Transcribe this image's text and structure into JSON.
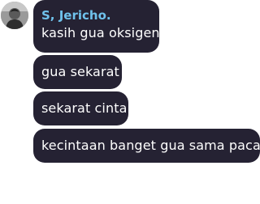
{
  "chat": {
    "sender_name": "S, Jericho.",
    "messages": [
      {
        "text": "kasih gua oksigen"
      },
      {
        "text": "gua sekarat"
      },
      {
        "text": "sekarat cinta"
      },
      {
        "text": "kecintaan banget gua sama pacar"
      }
    ]
  },
  "colors": {
    "bubble_background": "#252233",
    "sender_name": "#6fc2ec",
    "message_text": "#ffffff"
  }
}
